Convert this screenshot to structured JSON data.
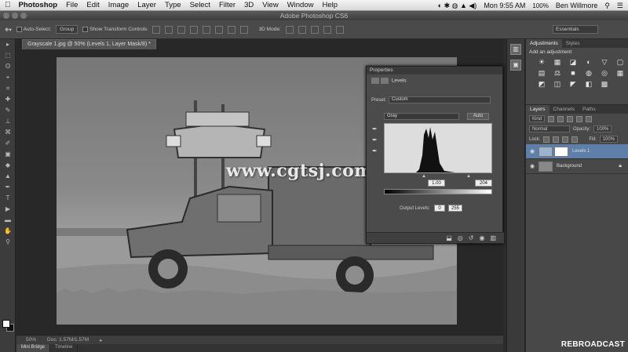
{
  "menubar": {
    "apple": "",
    "app": "Photoshop",
    "items": [
      "File",
      "Edit",
      "Image",
      "Layer",
      "Type",
      "Select",
      "Filter",
      "3D",
      "View",
      "Window",
      "Help"
    ],
    "time": "Mon 9:55 AM",
    "battery": "100%",
    "user": "Ben Willmore"
  },
  "window": {
    "title": "Adobe Photoshop CS6"
  },
  "options": {
    "auto_select": "Auto-Select:",
    "auto_select_value": "Group",
    "transform_controls": "Show Transform Controls",
    "mode_3d": "3D Mode:",
    "workspace": "Essentials"
  },
  "document": {
    "tab": "Grayscale 1.jpg @ 50% (Levels 1, Layer Mask/8) *",
    "zoom": "50%",
    "doc_size": "Doc: 1.57M/1.57M"
  },
  "bottom_tabs": [
    "Mini Bridge",
    "Timeline"
  ],
  "watermark": "www.cgtsj.com",
  "properties": {
    "panel_title": "Properties",
    "adjustment": "Levels",
    "preset_label": "Preset:",
    "preset_value": "Custom",
    "channel": "Gray",
    "auto_button": "Auto",
    "input_black": "1.00",
    "input_white": "204",
    "output_label": "Output Levels:",
    "output_black": "0",
    "output_white": "255"
  },
  "panels": {
    "adjustments_tab": "Adjustments",
    "styles_tab": "Styles",
    "add_adjustment": "Add an adjustment",
    "adjustment_icons_row1": [
      "☀",
      "▦",
      "◪",
      "◐",
      "▽",
      "▢"
    ],
    "adjustment_icons_row2": [
      "▤",
      "⚖",
      "■",
      "◍",
      "◎",
      "▦"
    ],
    "adjustment_icons_row3": [
      "◩",
      "◫",
      "◤",
      "◧",
      "▩",
      ""
    ],
    "layers_tab": "Layers",
    "channels_tab": "Channels",
    "paths_tab": "Paths",
    "kind_filter": "Kind",
    "blend_mode": "Normal",
    "opacity_label": "Opacity:",
    "opacity_value": "100%",
    "lock_label": "Lock:",
    "fill_label": "Fill:",
    "fill_value": "100%",
    "layers": [
      {
        "name": "Levels 1",
        "active": true
      },
      {
        "name": "Background",
        "active": false
      }
    ]
  },
  "tools": [
    "▸",
    "⬚",
    "ʘ",
    "⌖",
    "⌗",
    "✚",
    "✎",
    "⊥",
    "⌘",
    "✐",
    "▣",
    "◆",
    "▲",
    "✒",
    "T",
    "▶",
    "▬",
    "✋",
    "⚲"
  ],
  "branding": "REBROADCAST"
}
